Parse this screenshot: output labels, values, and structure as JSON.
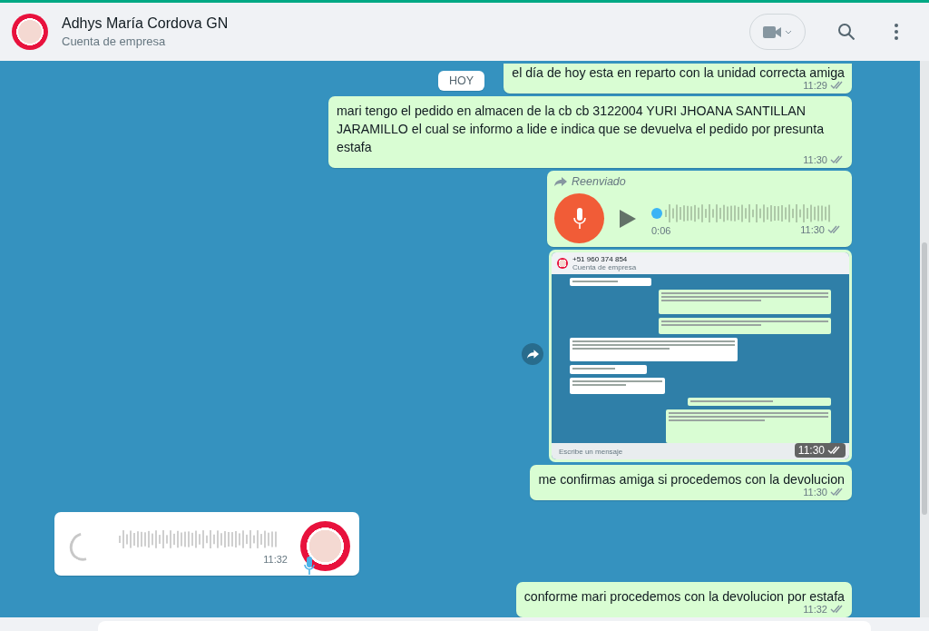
{
  "header": {
    "name": "Adhys María Cordova GN",
    "subtitle": "Cuenta de empresa"
  },
  "date_chip": "HOY",
  "messages": [
    {
      "kind": "text",
      "outgoing": true,
      "text": "el día de hoy esta en reparto con la unidad correcta amiga",
      "time": "11:29",
      "clipped": true
    },
    {
      "kind": "text",
      "outgoing": true,
      "text": "mari tengo el pedido en almacen de la cb  cb 3122004 YURI JHOANA SANTILLAN JARAMILLO el cual se informo a lide e indica que se devuelva el pedido por presunta estafa",
      "time": "11:30",
      "clipped": false
    },
    {
      "kind": "voice",
      "outgoing": true,
      "forwarded": "Reenviado",
      "duration": "0:06",
      "level": 0,
      "time": "11:30"
    },
    {
      "kind": "image",
      "outgoing": true,
      "time": "11:30",
      "shot": {
        "title": "+51 960 374 854",
        "subtitle": "Cuenta de empresa",
        "placeholder": "Escribe un mensaje"
      }
    },
    {
      "kind": "text",
      "outgoing": true,
      "text": "me confirmas amiga si procedemos con la devolucion",
      "time": "11:30",
      "clipped": false
    },
    {
      "kind": "voice",
      "outgoing": false,
      "loading": true,
      "time": "11:32"
    },
    {
      "kind": "text",
      "outgoing": true,
      "text": "conforme mari procedemos con la devolucion por estafa",
      "time": "11:32",
      "clipped": false
    }
  ]
}
